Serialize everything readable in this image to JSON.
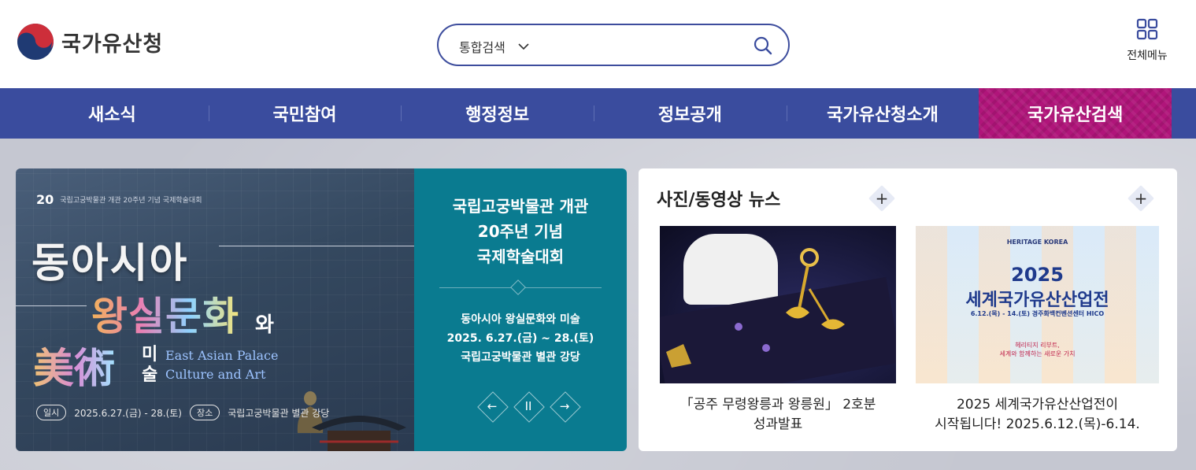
{
  "header": {
    "logo_text": "국가유산청",
    "search": {
      "scope": "통합검색",
      "placeholder": ""
    },
    "allmenu_label": "전체메뉴"
  },
  "nav": {
    "items": [
      "새소식",
      "국민참여",
      "행정정보",
      "정보공개",
      "국가유산청소개",
      "국가유산검색"
    ],
    "active_index": 5,
    "colors": {
      "bar": "#3a4c9e",
      "active": "#b0157a"
    }
  },
  "banner": {
    "image_small": "국립고궁박물관 개관 20주년 기념 국제학술대회",
    "image_logo": "20",
    "image_line1": "동아시아",
    "image_line2": "왕실문화",
    "image_wa": "와",
    "image_line3": "美術",
    "image_misul": "미술",
    "image_en1": "East Asian Palace",
    "image_en2": "Culture and Art",
    "image_date_label": "일시",
    "image_date": "2025.6.27.(금) - 28.(토)",
    "image_place_label": "장소",
    "image_place": "국립고궁박물관 별관 강당",
    "title_lines": [
      "국립고궁박물관 개관",
      "20주년 기념",
      "국제학술대회"
    ],
    "desc_lines": [
      "동아시아 왕실문화와 미술",
      "2025. 6.27.(금) ~ 28.(토)",
      "국립고궁박물관 별관 강당"
    ],
    "controls": {
      "prev": "←",
      "pause": "II",
      "next": "→"
    },
    "color": "#0a7b90"
  },
  "news": {
    "title": "사진/동영상 뉴스",
    "more_icon": "+",
    "cards": [
      {
        "caption_line1": "「공주 무령왕릉과 왕릉원」 2호분",
        "caption_line2": "성과발표"
      },
      {
        "caption_line1": "2025 세계국가유산산업전이",
        "caption_line2": "시작됩니다! 2025.6.12.(목)-6.14.",
        "poster_brand": "HERITAGE KOREA",
        "poster_year": "2025",
        "poster_title": "세계국가유산산업전",
        "poster_date": "6.12.(목) - 14.(토) 경주화백컨벤션센터 HICO",
        "poster_sub1": "헤리티지 리부트,",
        "poster_sub2": "세계와 함께하는 새로운 가치"
      }
    ]
  }
}
